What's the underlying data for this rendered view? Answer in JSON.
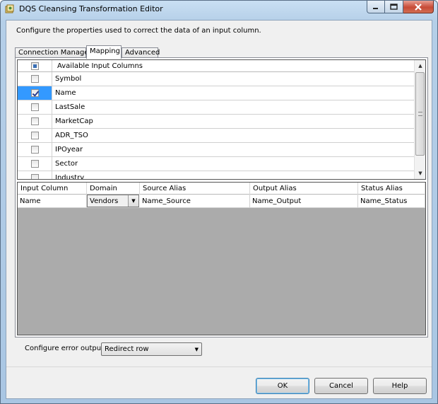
{
  "window": {
    "title": "DQS Cleansing Transformation Editor"
  },
  "description": "Configure the properties used to correct the data of an input column.",
  "tabs": [
    {
      "label": "Connection Manager",
      "active": false
    },
    {
      "label": "Mapping",
      "active": true
    },
    {
      "label": "Advanced",
      "active": false
    }
  ],
  "input_columns": {
    "header": "Available Input Columns",
    "rows": [
      {
        "name": "Symbol",
        "checked": false
      },
      {
        "name": "Name",
        "checked": true
      },
      {
        "name": "LastSale",
        "checked": false
      },
      {
        "name": "MarketCap",
        "checked": false
      },
      {
        "name": "ADR_TSO",
        "checked": false
      },
      {
        "name": "IPOyear",
        "checked": false
      },
      {
        "name": "Sector",
        "checked": false
      },
      {
        "name": "Industry",
        "checked": false
      }
    ]
  },
  "mapping": {
    "headers": {
      "input_column": "Input Column",
      "domain": "Domain",
      "source_alias": "Source Alias",
      "output_alias": "Output Alias",
      "status_alias": "Status Alias"
    },
    "rows": [
      {
        "input_column": "Name",
        "domain": "Vendors",
        "source_alias": "Name_Source",
        "output_alias": "Name_Output",
        "status_alias": "Name_Status"
      }
    ]
  },
  "error_output": {
    "label": "Configure error output:",
    "value": "Redirect row"
  },
  "buttons": {
    "ok": "OK",
    "cancel": "Cancel",
    "help": "Help"
  },
  "colors": {
    "selection": "#3399ff",
    "grid_empty": "#ababab"
  }
}
